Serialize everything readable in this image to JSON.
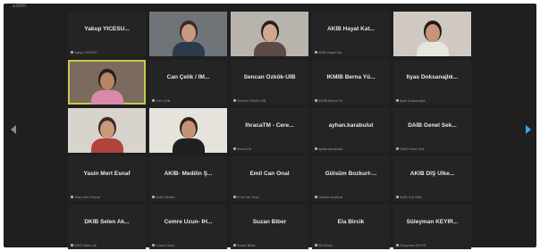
{
  "window": {
    "title": "Zoom"
  },
  "participants": [
    {
      "name": "Yakup YICESU...",
      "caption": "Yakup YICESU",
      "video": false
    },
    {
      "name": "",
      "caption": "",
      "video": true,
      "scene": "man-office"
    },
    {
      "name": "",
      "caption": "",
      "video": true,
      "scene": "woman-room"
    },
    {
      "name": "AKİB Hayat Kat...",
      "caption": "AKİB Hayat Kat",
      "video": false
    },
    {
      "name": "",
      "caption": "",
      "video": true,
      "scene": "young-man"
    },
    {
      "name": "",
      "caption": "",
      "video": true,
      "scene": "woman-pink",
      "active": true
    },
    {
      "name": "Can Çelik / İM...",
      "caption": "Can Çelik",
      "video": false
    },
    {
      "name": "Sencan Özkök-UİB",
      "caption": "Sencan Özkök-UİB",
      "video": false
    },
    {
      "name": "İKMİB Berna Yü...",
      "caption": "İKMİB Berna Yü",
      "video": false
    },
    {
      "name": "İlyas Doksanajlık...",
      "caption": "İlyas Doksanajlık",
      "video": false
    },
    {
      "name": "",
      "caption": "",
      "video": true,
      "scene": "woman-white"
    },
    {
      "name": "",
      "caption": "",
      "video": true,
      "scene": "man-dark"
    },
    {
      "name": "İhracaTM - Cere...",
      "caption": "İhracaTM",
      "video": false
    },
    {
      "name": "ayhan.karabulut",
      "caption": "ayhan.karabulut",
      "video": false
    },
    {
      "name": "DAİB Genel Sek...",
      "caption": "DAİB Genel Sek",
      "video": false
    },
    {
      "name": "Yasin Mert Esnaf",
      "caption": "Yasin Mert Esnaf",
      "video": false
    },
    {
      "name": "AKİB- Medilin Ş...",
      "caption": "AKİB Medilin",
      "video": false
    },
    {
      "name": "Emil Can Önal",
      "caption": "Emil Can Önal",
      "video": false
    },
    {
      "name": "Gülsüm Bozkurt-...",
      "caption": "Gülsüm Bozkurt",
      "video": false
    },
    {
      "name": "AKİB DIŞ Ülke...",
      "caption": "AKİB DIŞ Ülke",
      "video": false
    },
    {
      "name": "DKİB Selen Ak...",
      "caption": "DKİB Selen Ak",
      "video": false
    },
    {
      "name": "Cemre Uzun- İH...",
      "caption": "Cemre Uzun",
      "video": false
    },
    {
      "name": "Suzan Biber",
      "caption": "Suzan Biber",
      "video": false
    },
    {
      "name": "Ela Bircik",
      "caption": "Ela Bircik",
      "video": false
    },
    {
      "name": "Süleyman KEYİR...",
      "caption": "Süleyman KEYİR",
      "video": false
    }
  ],
  "colors": {
    "active_border": "#c9c94a",
    "next_arrow": "#3aa6ff",
    "tile_bg": "#242424"
  }
}
